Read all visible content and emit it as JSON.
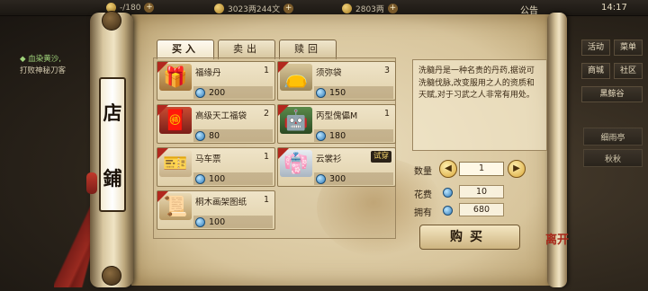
{
  "topbar": {
    "res1": "-/180",
    "res2": "3023两244文",
    "res3": "2803两",
    "notice": "公告",
    "time": "14:17"
  },
  "quest": {
    "title": "◆ 血染黄沙,",
    "desc": "打败神秘刀客"
  },
  "side_buttons": {
    "activity": "活动",
    "deal": "菜单",
    "shop": "商城",
    "social": "社区",
    "region": "黑鲸谷",
    "btn_a": "细雨亭",
    "btn_b": "秋秋"
  },
  "shop_sign": {
    "char1": "店",
    "char2": "鋪"
  },
  "tabs": {
    "buy": "买入",
    "sell": "卖出",
    "redeem": "赎回"
  },
  "items": [
    {
      "name": "福缘丹",
      "count": "1",
      "price": "200",
      "icon": "pill-bag-icon",
      "badge": ""
    },
    {
      "name": "须弥袋",
      "count": "3",
      "price": "150",
      "icon": "pouch-icon",
      "badge": ""
    },
    {
      "name": "高级天工福袋",
      "count": "2",
      "price": "80",
      "icon": "fortune-bag-icon",
      "badge": ""
    },
    {
      "name": "丙型傀儡M",
      "count": "1",
      "price": "180",
      "icon": "puppet-icon",
      "badge": ""
    },
    {
      "name": "马车票",
      "count": "1",
      "price": "100",
      "icon": "ticket-icon",
      "badge": ""
    },
    {
      "name": "云裳衫",
      "count": "",
      "price": "300",
      "icon": "robe-icon",
      "badge": "试穿"
    },
    {
      "name": "桐木画架图纸",
      "count": "1",
      "price": "100",
      "icon": "blueprint-icon",
      "badge": ""
    }
  ],
  "detail": {
    "description": "洗髓丹是一种名贵的丹药,据说可洗髓伐脉,改变服用之人的资质和天赋,对于习武之人非常有用处。",
    "qty_label": "数量",
    "qty_value": "1",
    "cost_label": "花费",
    "cost_value": "10",
    "own_label": "拥有",
    "own_value": "680",
    "buy_label": "购买"
  },
  "close_label": "离开",
  "colors": {
    "accent_red": "#b2281e",
    "money_blue": "#2f7ab8",
    "badge_gold": "#f4d36a"
  }
}
